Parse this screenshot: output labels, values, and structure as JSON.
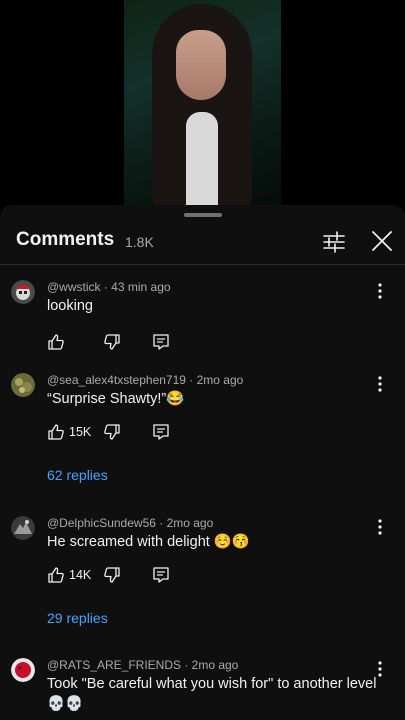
{
  "comments_panel": {
    "title": "Comments",
    "count": "1.8K"
  },
  "comments": [
    {
      "author": "@wwstick",
      "time": "43 min ago",
      "meta": "@wwstick · 43 min ago",
      "text": "looking",
      "likes": "",
      "replies": ""
    },
    {
      "author": "@sea_alex4txstephen719",
      "time": "2mo ago",
      "meta": "@sea_alex4txstephen719 · 2mo ago",
      "text": "“Surprise Shawty!”😂",
      "likes": "15K",
      "replies": "62 replies"
    },
    {
      "author": "@DelphicSundew56",
      "time": "2mo ago",
      "meta": "@DelphicSundew56 · 2mo ago",
      "text": "He screamed with delight ☺️😚",
      "likes": "14K",
      "replies": "29 replies"
    },
    {
      "author": "@RATS_ARE_FRIENDS",
      "time": "2mo ago",
      "meta": "@RATS_ARE_FRIENDS · 2mo ago",
      "text": "Took \"Be careful what you wish for\" to another level",
      "text_line2": "💀💀",
      "likes": "",
      "replies": ""
    }
  ],
  "icons": {
    "like": "thumbs-up-icon",
    "dislike": "thumbs-down-icon",
    "reply": "reply-comment-icon",
    "more": "more-vertical-icon",
    "filter": "sliders-icon",
    "close": "close-icon"
  },
  "colors": {
    "background": "#0f0f0f",
    "text": "#f1f1f1",
    "secondary_text": "#aaaaaa",
    "link": "#3ea6ff"
  }
}
